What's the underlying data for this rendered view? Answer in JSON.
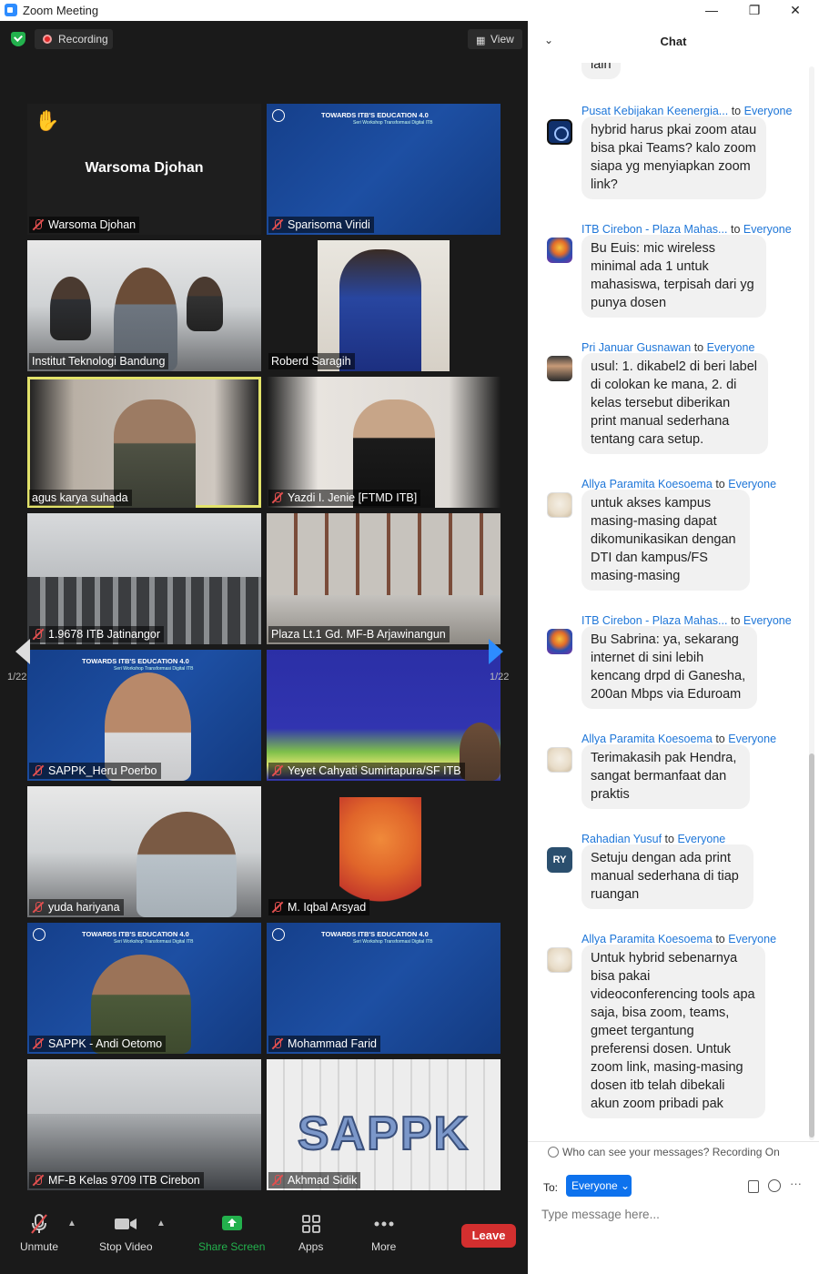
{
  "window": {
    "title": "Zoom Meeting",
    "minimize": "—",
    "maximize": "❐",
    "close": "✕"
  },
  "status": {
    "recording_label": "Recording",
    "view_label": "View"
  },
  "tiles": [
    {
      "name": "Warsoma Djohan",
      "big_name": "Warsoma Djohan",
      "muted": true,
      "hand_raised": true
    },
    {
      "name": "Sparisoma Viridi",
      "muted": true,
      "banner_title": "TOWARDS ITB'S EDUCATION 4.0",
      "banner_sub": "Seri Workshop Transformasi Digital ITB"
    },
    {
      "name": "Institut Teknologi Bandung",
      "muted": false
    },
    {
      "name": "Roberd Saragih",
      "muted": false
    },
    {
      "name": "agus karya suhada",
      "muted": false,
      "speaking": true
    },
    {
      "name": "Yazdi I. Jenie [FTMD ITB]",
      "muted": true
    },
    {
      "name": "1.9678 ITB Jatinangor",
      "muted": true
    },
    {
      "name": "Plaza Lt.1 Gd. MF-B Arjawinangun",
      "muted": false
    },
    {
      "name": "SAPPK_Heru Poerbo",
      "muted": true,
      "banner_title": "TOWARDS ITB'S EDUCATION 4.0",
      "banner_sub": "Seri Workshop Transformasi Digital ITB"
    },
    {
      "name": "Yeyet Cahyati Sumirtapura/SF ITB",
      "muted": true
    },
    {
      "name": "yuda hariyana",
      "muted": true
    },
    {
      "name": "M. Iqbal Arsyad",
      "muted": true
    },
    {
      "name": "SAPPK - Andi Oetomo",
      "muted": true,
      "banner_title": "TOWARDS ITB'S EDUCATION 4.0",
      "banner_sub": "Seri Workshop Transformasi Digital ITB"
    },
    {
      "name": "Mohammad Farid",
      "muted": true,
      "banner_title": "TOWARDS ITB'S EDUCATION 4.0",
      "banner_sub": "Seri Workshop Transformasi Digital ITB"
    },
    {
      "name": "MF-B Kelas 9709 ITB Cirebon",
      "muted": true
    },
    {
      "name": "Akhmad Sidik",
      "muted": true,
      "overlay_text": "SAPPK"
    }
  ],
  "pager": {
    "left_page": "1/22",
    "right_page": "1/22"
  },
  "toolbar": {
    "unmute": "Unmute",
    "stop_video": "Stop Video",
    "share_screen": "Share Screen",
    "apps": "Apps",
    "more": "More",
    "leave": "Leave",
    "share_color": "#23b14d",
    "leave_color": "#d32f2f"
  },
  "chat": {
    "title": "Chat",
    "to_word": "to",
    "messages": [
      {
        "sender": "",
        "to": "",
        "text": "lain",
        "avatar": "none"
      },
      {
        "sender": "Pusat Kebijakan Keenergia...",
        "to": "Everyone",
        "text": "hybrid harus pkai zoom atau bisa pkai Teams?  kalo zoom siapa yg menyiapkan zoom link?",
        "avatar": "pusat"
      },
      {
        "sender": "ITB Cirebon - Plaza Mahas...",
        "to": "Everyone",
        "text": "Bu Euis: mic wireless minimal ada 1 untuk mahasiswa, terpisah dari yg punya dosen",
        "avatar": "itb"
      },
      {
        "sender": "Pri Januar Gusnawan",
        "to": "Everyone",
        "text": "usul: 1. dikabel2 di beri label di colokan ke mana, 2. di kelas tersebut diberikan print manual sederhana tentang cara setup.",
        "avatar": "pri"
      },
      {
        "sender": "Allya Paramita Koesoema",
        "to": "Everyone",
        "text": "untuk akses kampus masing-masing dapat dikomunikasikan dengan DTI dan kampus/FS masing-masing",
        "avatar": "allya"
      },
      {
        "sender": "ITB Cirebon - Plaza Mahas...",
        "to": "Everyone",
        "text": "Bu Sabrina: ya, sekarang internet di sini lebih kencang drpd di Ganesha, 200an Mbps via Eduroam",
        "avatar": "itb"
      },
      {
        "sender": "Allya Paramita Koesoema",
        "to": "Everyone",
        "text": "Terimakasih pak Hendra, sangat bermanfaat dan praktis",
        "avatar": "allya"
      },
      {
        "sender": "Rahadian Yusuf",
        "to": "Everyone",
        "text": "Setuju dengan ada print manual sederhana di tiap ruangan",
        "avatar": "ry",
        "initials": "RY"
      },
      {
        "sender": "Allya Paramita Koesoema",
        "to": "Everyone",
        "text": "Untuk hybrid sebenarnya bisa pakai videoconferencing tools apa saja, bisa zoom, teams, gmeet tergantung preferensi dosen. Untuk zoom link, masing-masing dosen itb telah dibekali akun zoom pribadi pak",
        "avatar": "allya"
      }
    ],
    "footer": {
      "who_can_see": "Who can see your messages? Recording On",
      "to_label": "To:",
      "to_value": "Everyone",
      "input_placeholder": "Type message here..."
    }
  }
}
